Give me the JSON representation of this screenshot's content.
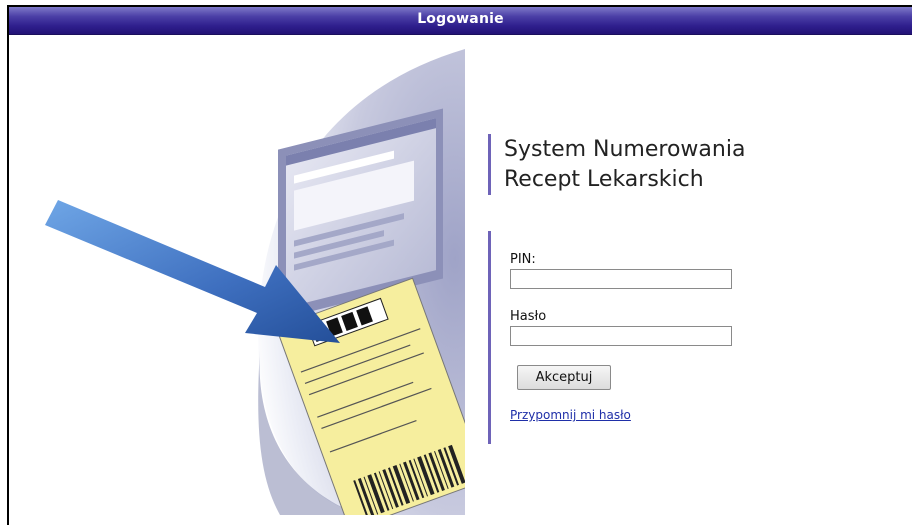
{
  "header": {
    "title": "Logowanie"
  },
  "app": {
    "system_title": "System Numerowania\nRecept Lekarskich"
  },
  "form": {
    "pin_label": "PIN:",
    "pin_value": "",
    "password_label": "Hasło",
    "password_value": "",
    "submit_label": "Akceptuj",
    "forgot_link": "Przypomnij mi hasło"
  },
  "colors": {
    "titlebar": "#2f1f8d",
    "accent_bar": "#6e63b8",
    "arrow": "#3f74c9",
    "prescription": "#f4eb9e"
  }
}
